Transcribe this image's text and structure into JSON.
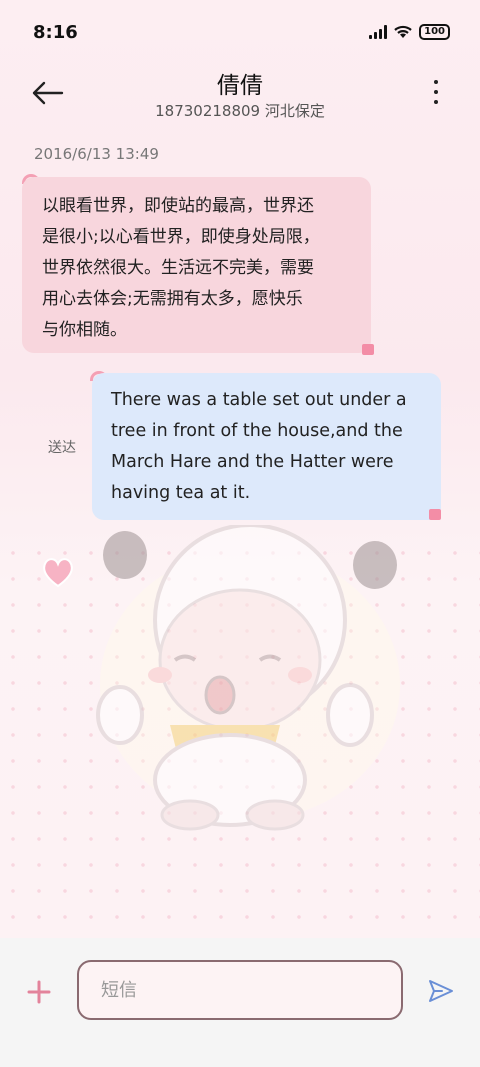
{
  "status_bar": {
    "time": "8:16",
    "battery": "100"
  },
  "header": {
    "title": "倩倩",
    "subtitle": "18730218809 河北保定"
  },
  "thread": {
    "timestamp": "2016/6/13 13:49",
    "incoming": [
      "以眼看世界，即使站的最高，世界还",
      "是很小;以心看世界，即使身处局限，",
      "世界依然很大。生活远不完美，需要",
      "用心去体会;无需拥有太多，愿快乐",
      "与你相随。"
    ],
    "outgoing": [
      "There was a table set out under a",
      "tree in front of the house,and the",
      "March Hare and the Hatter were",
      "having tea at it."
    ],
    "sent_status": "送达"
  },
  "composer": {
    "placeholder": "短信"
  },
  "icons": {
    "back": "back-arrow-icon",
    "more": "more-vertical-icon",
    "add": "plus-icon",
    "send": "send-icon"
  },
  "colors": {
    "accent": "#e3839b",
    "incoming_bubble": "#f8d6dd",
    "outgoing_bubble": "#dde9fb"
  }
}
